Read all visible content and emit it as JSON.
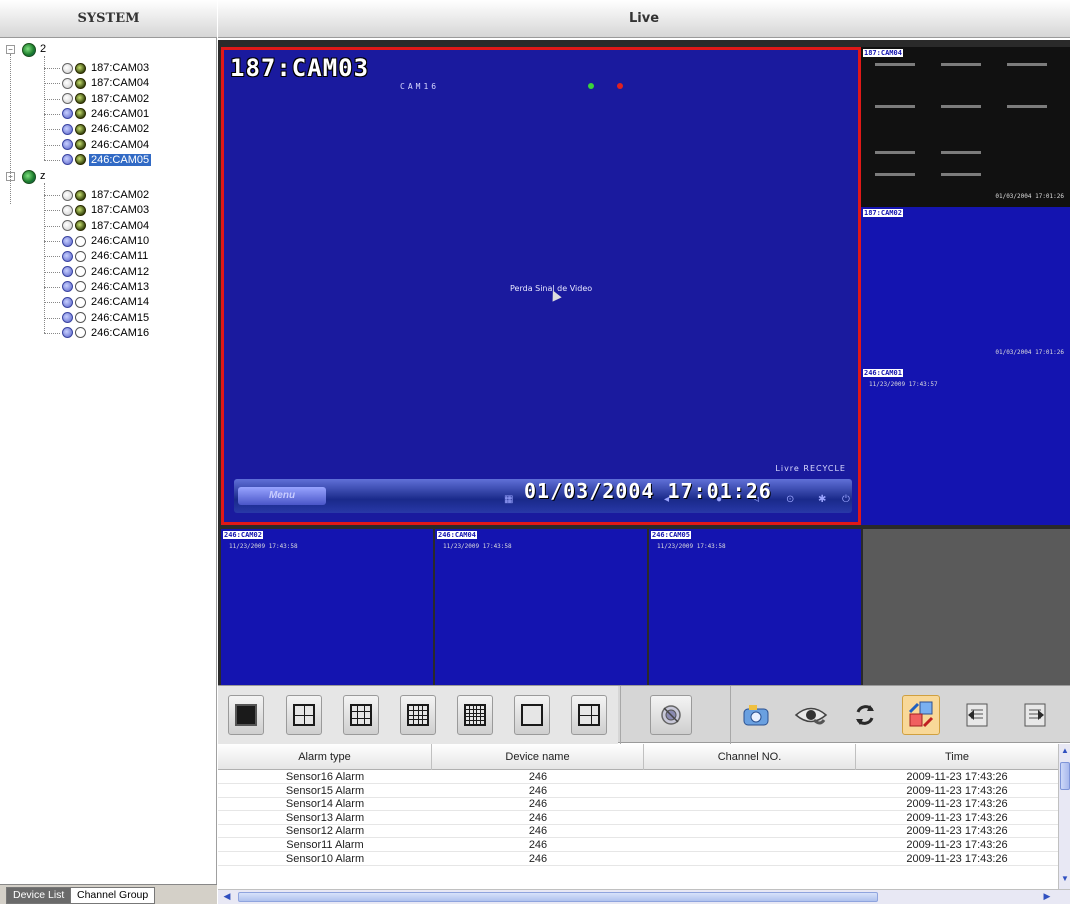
{
  "left_panel": {
    "title": "SYSTEM",
    "groups": [
      {
        "label": "2",
        "items": [
          {
            "label": "187:CAM03",
            "dot_a": "white",
            "dot_b": "green",
            "selected": false
          },
          {
            "label": "187:CAM04",
            "dot_a": "white",
            "dot_b": "green",
            "selected": false
          },
          {
            "label": "187:CAM02",
            "dot_a": "white",
            "dot_b": "green",
            "selected": false
          },
          {
            "label": "246:CAM01",
            "dot_a": "blue",
            "dot_b": "green",
            "selected": false
          },
          {
            "label": "246:CAM02",
            "dot_a": "blue",
            "dot_b": "green",
            "selected": false
          },
          {
            "label": "246:CAM04",
            "dot_a": "blue",
            "dot_b": "green",
            "selected": false
          },
          {
            "label": "246:CAM05",
            "dot_a": "blue",
            "dot_b": "green",
            "selected": true
          }
        ]
      },
      {
        "label": "z",
        "items": [
          {
            "label": "187:CAM02",
            "dot_a": "white",
            "dot_b": "green",
            "selected": false
          },
          {
            "label": "187:CAM03",
            "dot_a": "white",
            "dot_b": "green",
            "selected": false
          },
          {
            "label": "187:CAM04",
            "dot_a": "white",
            "dot_b": "green",
            "selected": false
          },
          {
            "label": "246:CAM10",
            "dot_a": "blue",
            "dot_b": "hollow",
            "selected": false
          },
          {
            "label": "246:CAM11",
            "dot_a": "blue",
            "dot_b": "hollow",
            "selected": false
          },
          {
            "label": "246:CAM12",
            "dot_a": "blue",
            "dot_b": "hollow",
            "selected": false
          },
          {
            "label": "246:CAM13",
            "dot_a": "blue",
            "dot_b": "hollow",
            "selected": false
          },
          {
            "label": "246:CAM14",
            "dot_a": "blue",
            "dot_b": "hollow",
            "selected": false
          },
          {
            "label": "246:CAM15",
            "dot_a": "blue",
            "dot_b": "hollow",
            "selected": false
          },
          {
            "label": "246:CAM16",
            "dot_a": "blue",
            "dot_b": "hollow",
            "selected": false
          }
        ]
      }
    ],
    "tabs": {
      "device_list": "Device List",
      "channel_group": "Channel Group"
    }
  },
  "live": {
    "title": "Live",
    "main_video": {
      "camera_title": "187:CAM03",
      "sub_label": "CAM16",
      "center_text": "Perda Sinal de Video",
      "status_text": "Livre RECYCLE",
      "menu_label": "Menu",
      "datetime": "01/03/2004 17:01:26"
    },
    "side_videos": [
      {
        "label": "187:CAM04",
        "time": "01/03/2004 17:01:26"
      },
      {
        "label": "187:CAM02",
        "time": "01/03/2004 17:01:26"
      },
      {
        "label": "246:CAM01",
        "time": "11/23/2009 17:43:57"
      }
    ],
    "bottom_videos": [
      {
        "label": "246:CAM02",
        "time": "11/23/2009 17:43:58"
      },
      {
        "label": "246:CAM04",
        "time": "11/23/2009 17:43:58"
      },
      {
        "label": "246:CAM05",
        "time": "11/23/2009 17:43:58"
      }
    ]
  },
  "toolbar": {
    "layout_buttons": [
      "layout-1",
      "layout-4",
      "layout-9",
      "layout-16",
      "layout-25",
      "layout-36",
      "layout-custom"
    ],
    "icons": [
      "audio-icon",
      "snapshot-icon",
      "eye-icon",
      "cycle-icon",
      "layout-edit-icon",
      "prev-page-icon",
      "next-page-icon"
    ]
  },
  "alarm_table": {
    "columns": [
      "Alarm type",
      "Device name",
      "Channel NO.",
      "Time"
    ],
    "rows": [
      [
        "Sensor16 Alarm",
        "246",
        "",
        "2009-11-23 17:43:26"
      ],
      [
        "Sensor15 Alarm",
        "246",
        "",
        "2009-11-23 17:43:26"
      ],
      [
        "Sensor14 Alarm",
        "246",
        "",
        "2009-11-23 17:43:26"
      ],
      [
        "Sensor13 Alarm",
        "246",
        "",
        "2009-11-23 17:43:26"
      ],
      [
        "Sensor12 Alarm",
        "246",
        "",
        "2009-11-23 17:43:26"
      ],
      [
        "Sensor11 Alarm",
        "246",
        "",
        "2009-11-23 17:43:26"
      ],
      [
        "Sensor10 Alarm",
        "246",
        "",
        "2009-11-23 17:43:26"
      ]
    ]
  },
  "colors": {
    "video_blue": "#1414b0",
    "active_border": "#e01818",
    "selection": "#316ac5"
  }
}
